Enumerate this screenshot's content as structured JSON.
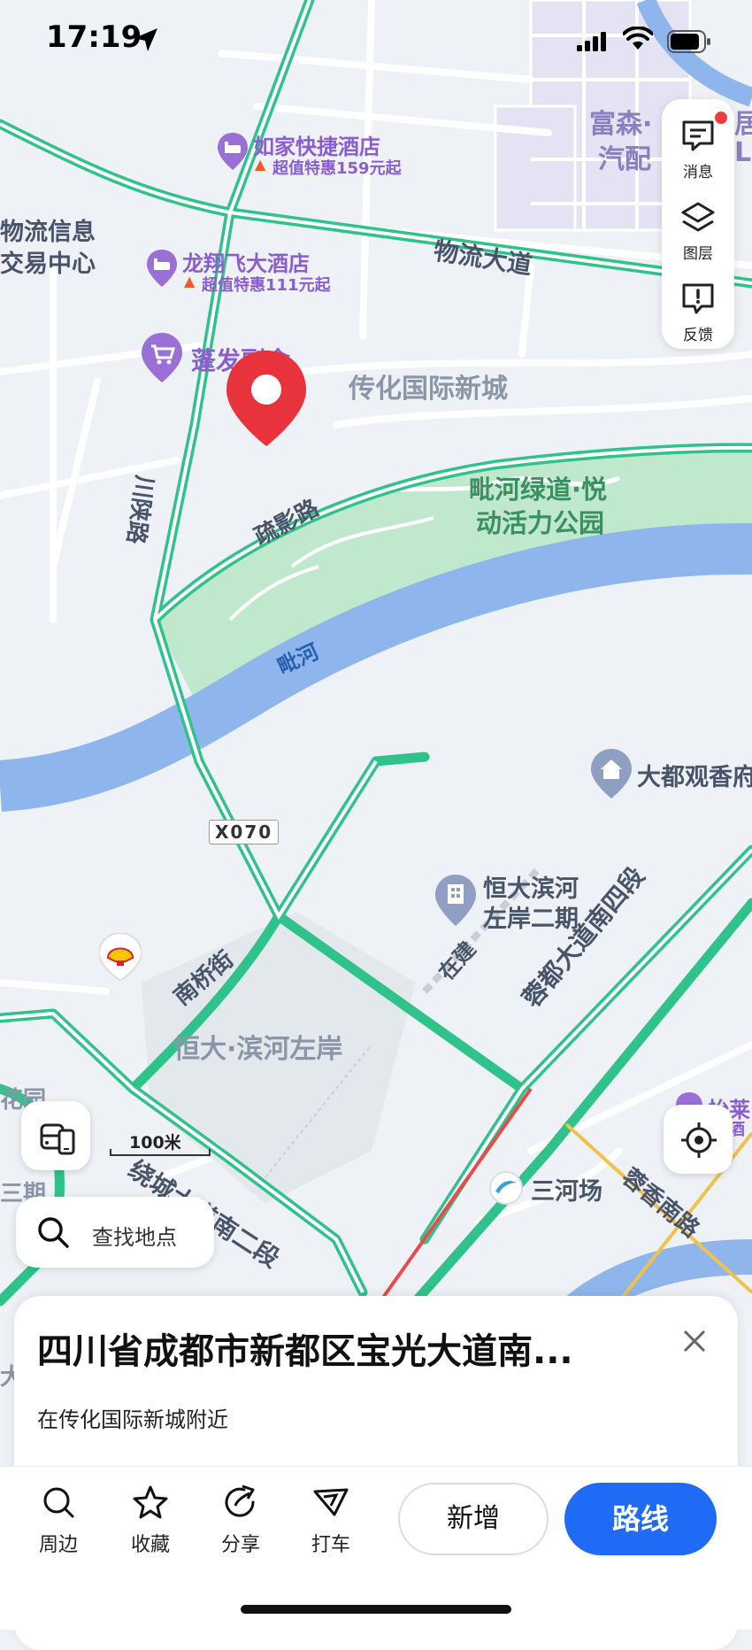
{
  "status_bar": {
    "time": "17:19"
  },
  "map": {
    "pois": [
      {
        "name": "如家快捷酒店",
        "promo": "超值特惠159元起"
      },
      {
        "name": "龙翔飞大酒店",
        "promo": "超值特惠111元起"
      },
      {
        "name": "蓬发副食"
      },
      {
        "name": "恒大滨河左岸二期"
      },
      {
        "name": "大都观香府"
      },
      {
        "name": "三河场"
      }
    ],
    "roads": {
      "wuliu": "物流大道",
      "chuanshan": "川陕路",
      "shuying": "疏影路",
      "pihe": "毗河",
      "nanqiao": "南桥街",
      "raocheng": "绕城大道南二段",
      "rongdu": "蓉都大道南四段",
      "rongxiang": "蓉香南路",
      "x070": "X070",
      "zaijian": "在建"
    },
    "areas": {
      "wuliu_info": "物流信息交易中心",
      "wuliu_info_1": "物流信息",
      "wuliu_info_2": "交易中心",
      "chuanhua": "传化国际新城",
      "park_1": "毗河绿道·悦",
      "park_2": "动活力公园",
      "evergrande": "恒大·滨河左岸",
      "fusen_1": "富森·",
      "fusen_2": "汽配",
      "ju": "居",
      "l": "L",
      "hua": "花园",
      "sanqi": "三期",
      "yilai_1": "怡莱",
      "yilai_2": "酒",
      "da": "大"
    },
    "scale_label": "100米"
  },
  "side_panel": {
    "message": "消息",
    "layers": "图层",
    "feedback": "反馈"
  },
  "search": {
    "placeholder": "查找地点"
  },
  "sheet": {
    "title": "四川省成都市新都区宝光大道南...",
    "subtitle": "在传化国际新城附近"
  },
  "toolbar": {
    "nearby": "周边",
    "favorite": "收藏",
    "share": "分享",
    "taxi": "打车",
    "add": "新增",
    "route": "路线"
  },
  "colors": {
    "accent": "#1f6bf5",
    "road_green": "#2fc28a",
    "river": "#8fb6ec",
    "park": "#bfe8cc",
    "poi_purple": "#9a6fd6",
    "pin_red": "#e8323c"
  }
}
